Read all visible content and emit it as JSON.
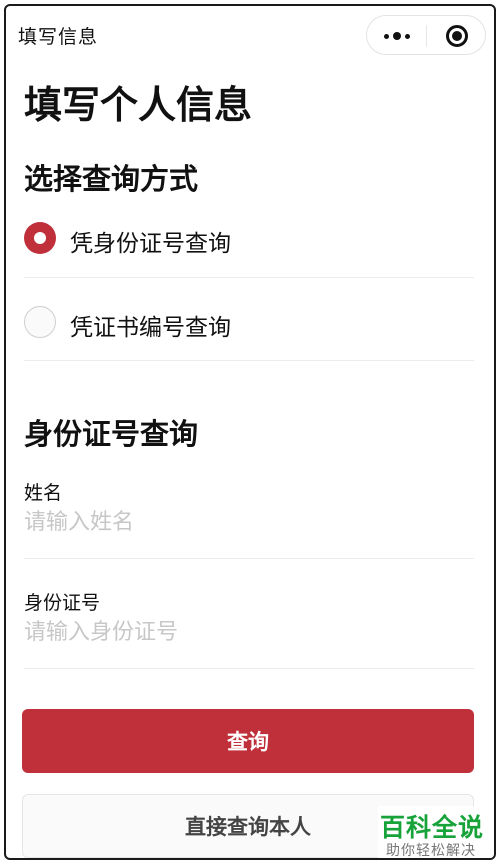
{
  "navbar": {
    "title": "填写信息",
    "more_icon": "more-dots-icon",
    "close_icon": "close-circle-icon"
  },
  "page": {
    "title": "填写个人信息"
  },
  "query_method": {
    "section_title": "选择查询方式",
    "options": [
      {
        "label": "凭身份证号查询",
        "selected": true
      },
      {
        "label": "凭证书编号查询",
        "selected": false
      }
    ]
  },
  "id_query": {
    "section_title": "身份证号查询",
    "name_label": "姓名",
    "name_placeholder": "请输入姓名",
    "id_label": "身份证号",
    "id_placeholder": "请输入身份证号"
  },
  "actions": {
    "query_label": "查询",
    "direct_query_label": "直接查询本人"
  },
  "watermark": {
    "title": "百科全说",
    "subtitle": "助你轻松解决"
  },
  "colors": {
    "accent": "#c0303b",
    "watermark_green": "#18a33a"
  }
}
